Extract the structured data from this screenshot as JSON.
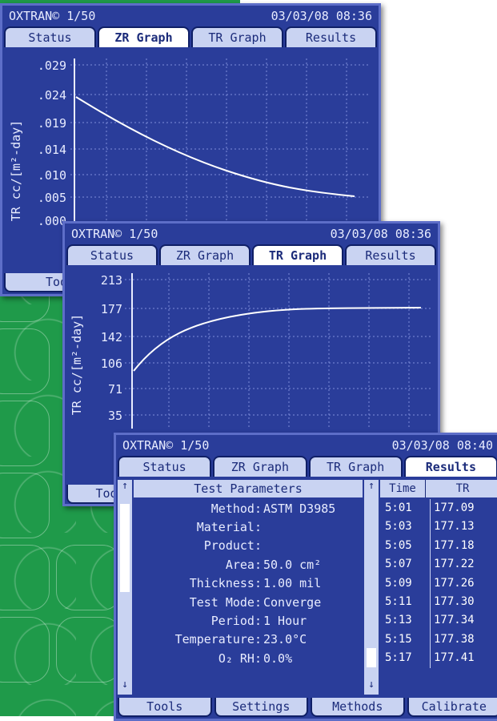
{
  "colors": {
    "screen_bg": "#2a3d9a",
    "tab_bg": "#c9d3f2",
    "tab_active": "#ffffff",
    "text": "#e8ecff",
    "green_bg": "#1f9a4a"
  },
  "screen_zr": {
    "header_left": "OXTRAN© 1/50",
    "header_right": "03/03/08 08:36",
    "tabs": [
      "Status",
      "ZR Graph",
      "TR Graph",
      "Results"
    ],
    "active_tab": "ZR Graph",
    "y_axis_label": "TR cc/[m²-day]",
    "y_ticks": [
      ".029",
      ".024",
      ".019",
      ".014",
      ".010",
      ".005",
      ".000"
    ],
    "bottom_button_partial": "Tool"
  },
  "screen_tr": {
    "header_left": "OXTRAN© 1/50",
    "header_right": "03/03/08 08:36",
    "tabs": [
      "Status",
      "ZR Graph",
      "TR Graph",
      "Results"
    ],
    "active_tab": "TR Graph",
    "y_axis_label": "TR cc/[m²-day]",
    "y_ticks": [
      "213",
      "177",
      "142",
      "106",
      "71",
      "35"
    ],
    "bottom_button_partial": "Too"
  },
  "screen_results": {
    "header_left": "OXTRAN© 1/50",
    "header_right": "03/03/08 08:40",
    "tabs": [
      "Status",
      "ZR Graph",
      "TR Graph",
      "Results"
    ],
    "active_tab": "Results",
    "panel_title": "Test Parameters",
    "params": [
      {
        "label": "Method:",
        "value": "ASTM D3985"
      },
      {
        "label": "Material:",
        "value": ""
      },
      {
        "label": "Product:",
        "value": ""
      },
      {
        "label": "Area:",
        "value": "50.0 cm²"
      },
      {
        "label": "Thickness:",
        "value": "1.00 mil"
      },
      {
        "label": "Test Mode:",
        "value": "Converge"
      },
      {
        "label": "Period:",
        "value": "1 Hour"
      },
      {
        "label": "Temperature:",
        "value": "23.0°C"
      },
      {
        "label": "O₂ RH:",
        "value": "0.0%"
      }
    ],
    "table_headers": [
      "Time",
      "TR"
    ],
    "table_rows": [
      [
        "5:01",
        "177.09"
      ],
      [
        "5:03",
        "177.13"
      ],
      [
        "5:05",
        "177.18"
      ],
      [
        "5:07",
        "177.22"
      ],
      [
        "5:09",
        "177.26"
      ],
      [
        "5:11",
        "177.30"
      ],
      [
        "5:13",
        "177.34"
      ],
      [
        "5:15",
        "177.38"
      ],
      [
        "5:17",
        "177.41"
      ]
    ],
    "bottom_buttons": [
      "Tools",
      "Settings",
      "Methods",
      "Calibrate"
    ]
  }
}
